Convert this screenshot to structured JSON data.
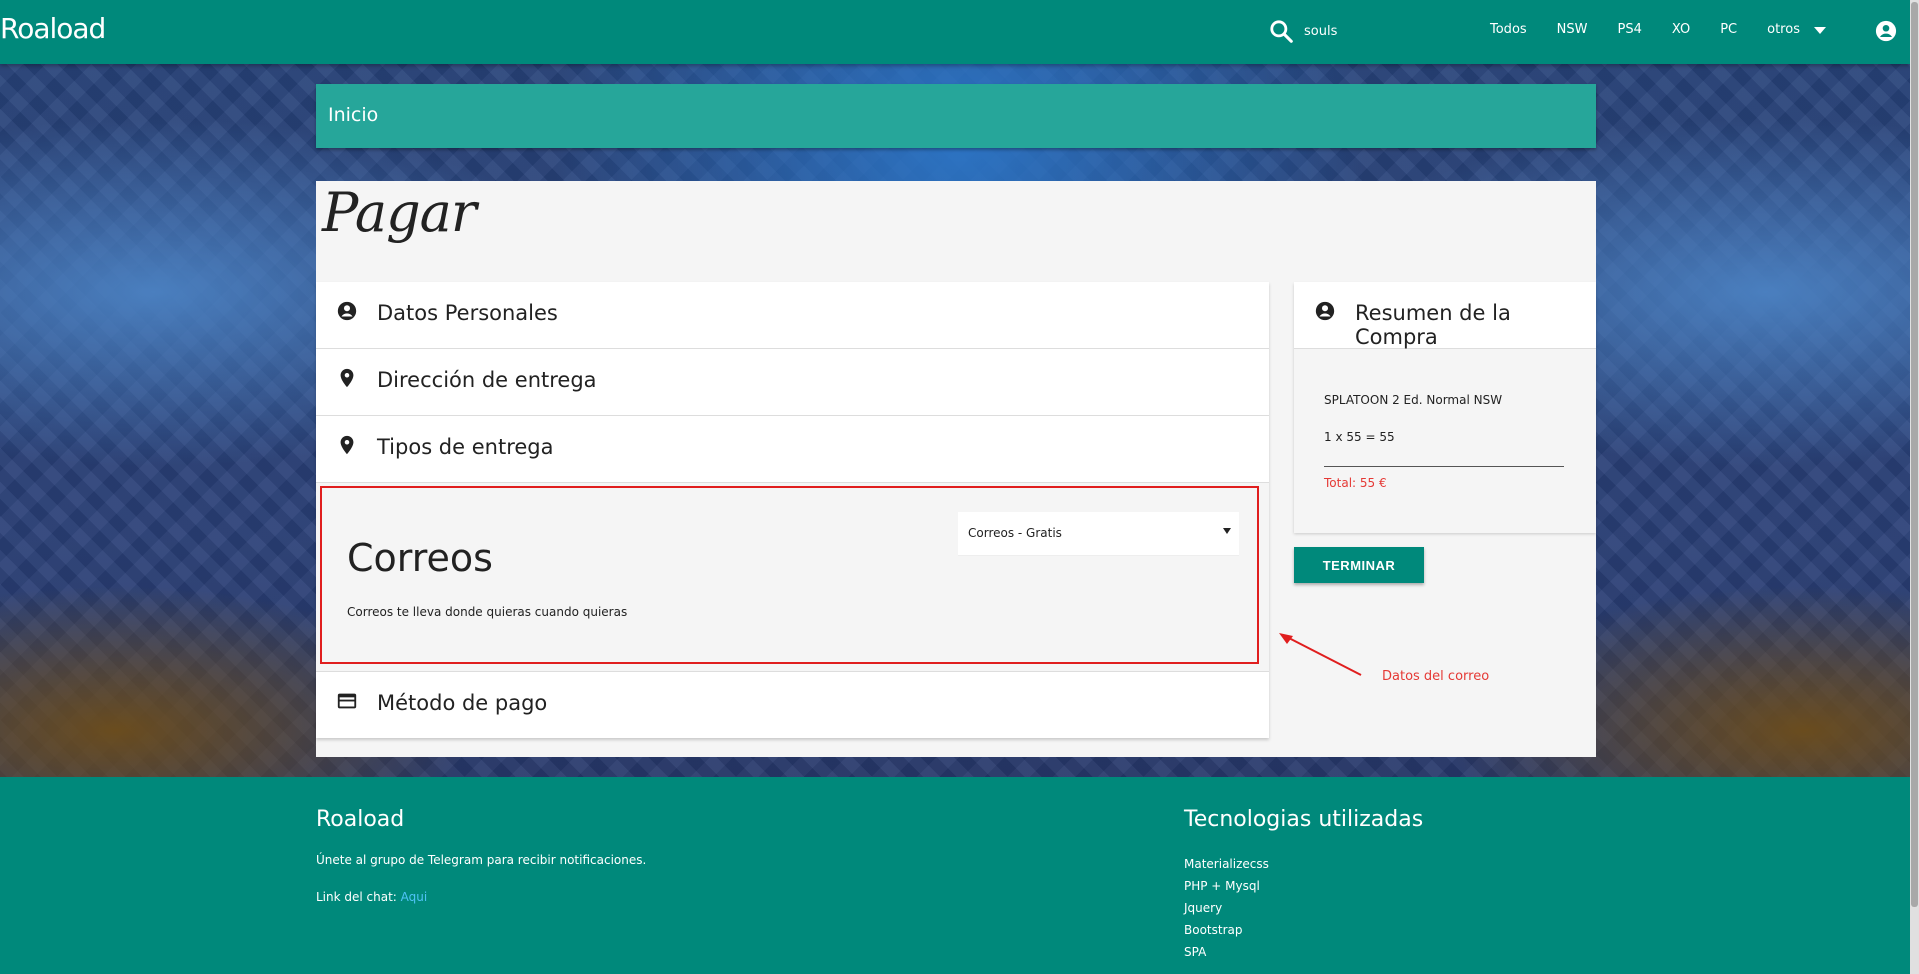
{
  "navbar": {
    "brand": "Roaload",
    "search_value": "souls",
    "links": [
      "Todos",
      "NSW",
      "PS4",
      "XO",
      "PC",
      "otros"
    ]
  },
  "breadcrumb": {
    "label": "Inicio"
  },
  "page_title": "Pagar",
  "sections": {
    "personal": "Datos Personales",
    "address": "Dirección de entrega",
    "delivery_types": "Tipos de entrega",
    "payment": "Método de pago"
  },
  "delivery": {
    "title": "Correos",
    "description": "Correos te lleva donde quieras cuando quieras",
    "selected_option": "Correos - Gratis"
  },
  "summary": {
    "title": "Resumen de la Compra",
    "item": "SPLATOON 2 Ed. Normal NSW",
    "calc": "1 x 55 = 55",
    "total": "Total: 55 €"
  },
  "finish_button": "TERMINAR",
  "annotation": "Datos del correo",
  "footer": {
    "brand": "Roaload",
    "telegram_text": "Únete al grupo de Telegram para recibir notificaciones.",
    "chat_label": "Link del chat:",
    "chat_link": "Aqui",
    "tech_title": "Tecnologias utilizadas",
    "tech": [
      "Materializecss",
      "PHP + Mysql",
      "Jquery",
      "Bootstrap",
      "SPA"
    ]
  },
  "colors": {
    "primary": "#00897b",
    "breadcrumb": "#26a69a",
    "highlight": "#e01e1e",
    "total": "#e53935"
  }
}
